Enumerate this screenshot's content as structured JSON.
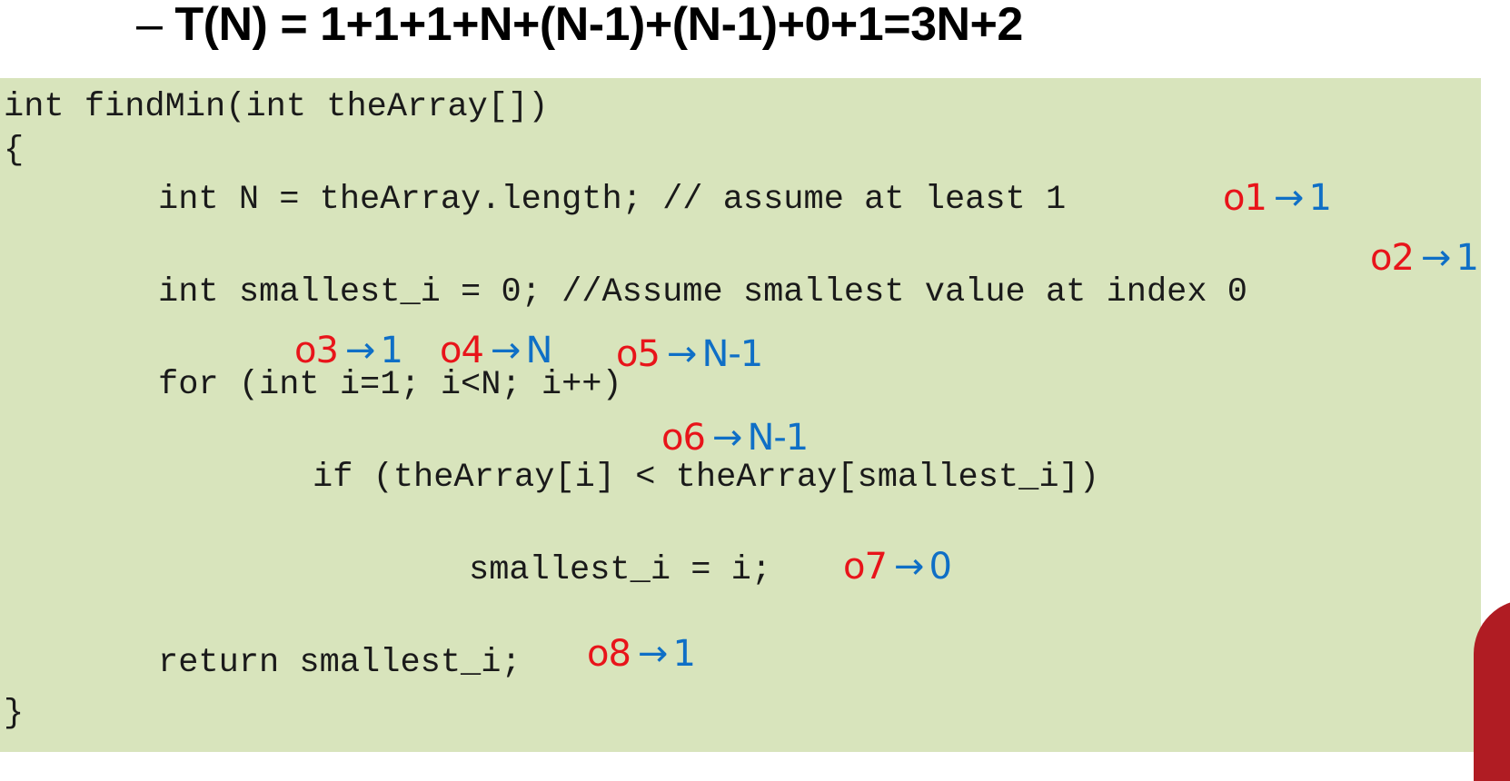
{
  "heading": {
    "dash": "–",
    "formula": "T(N) = 1+1+1+N+(N-1)+(N-1)+0+1=3N+2"
  },
  "code": {
    "lines": [
      "int findMin(int theArray[])",
      "{",
      "int N = theArray.length; // assume at least 1",
      "int smallest_i = 0; //Assume smallest value at index 0",
      "for (int i=1; i<N; i++)",
      "if (theArray[i] < theArray[smallest_i])",
      "smallest_i = i;",
      "return smallest_i;",
      "}"
    ]
  },
  "annotations": [
    {
      "op": "o1",
      "arrow": "→",
      "cost": "1"
    },
    {
      "op": "o2",
      "arrow": "→",
      "cost": "1"
    },
    {
      "op": "o3",
      "arrow": "→",
      "cost": "1"
    },
    {
      "op": "o4",
      "arrow": "→",
      "cost": "N"
    },
    {
      "op": "o5",
      "arrow": "→",
      "cost": "N-1"
    },
    {
      "op": "o6",
      "arrow": "→",
      "cost": "N-1"
    },
    {
      "op": "o7",
      "arrow": "→",
      "cost": "0"
    },
    {
      "op": "o8",
      "arrow": "→",
      "cost": "1"
    }
  ],
  "colors": {
    "code_background": "#d8e4bc",
    "operation_label": "#e8141a",
    "cost_value": "#0f6fc6",
    "accent_shape": "#b01c23"
  }
}
